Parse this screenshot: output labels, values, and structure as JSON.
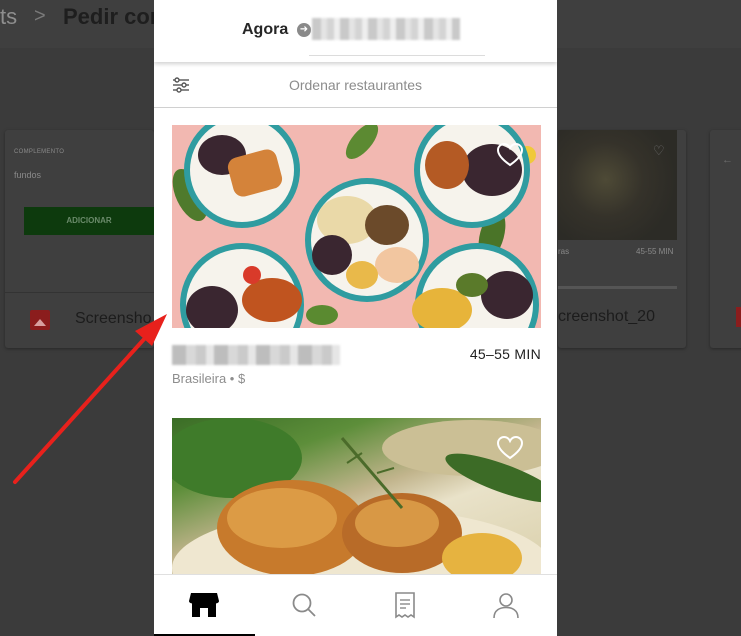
{
  "background": {
    "breadcrumb_partial": "ts",
    "breadcrumb_sep": ">",
    "page_title": "Pedir cor",
    "left_card": {
      "label": "COMPLEMENTO",
      "value": "fundos",
      "add_button": "ADICIONAR",
      "file_label": "Screensho"
    },
    "right_card": {
      "category": "ras",
      "time": "45-55 MIN",
      "file_label": "creenshot_20"
    }
  },
  "app": {
    "header": {
      "time": "Agora"
    },
    "sort_label": "Ordenar restaurantes",
    "restaurants": [
      {
        "eta": "45–55 MIN",
        "subtitle": "Brasileira • $"
      }
    ],
    "nav": [
      "store-icon",
      "search-icon",
      "receipt-icon",
      "profile-icon"
    ]
  },
  "colors": {
    "annotation_arrow": "#e8211c",
    "overlay": "#3b3b3b"
  }
}
